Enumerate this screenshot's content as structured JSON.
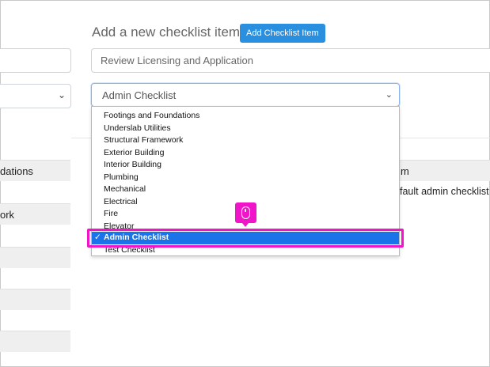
{
  "left_panel": {
    "rows": [
      "dations",
      "",
      "ork",
      "",
      "",
      "",
      ""
    ]
  },
  "header": {
    "title": "Add a new checklist item",
    "add_button": "Add Checklist Item"
  },
  "item_input": {
    "value": "Review Licensing and Application"
  },
  "checklist_select": {
    "value": "Admin Checklist",
    "options": [
      "Footings and Foundations",
      "Underslab Utilities",
      "Structural Framework",
      "Exterior Building",
      "Interior Building",
      "Plumbing",
      "Mechanical",
      "Electrical",
      "Fire",
      "Elevator",
      "Admin Checklist",
      "Test Checklist"
    ],
    "selected_index": 10,
    "check_mark": "✓"
  },
  "right_table": {
    "header": "m",
    "cell": "fault admin checklist"
  },
  "colors": {
    "accent": "#2b8fe0",
    "selection": "#1a73e8",
    "highlight": "#f015c8"
  }
}
